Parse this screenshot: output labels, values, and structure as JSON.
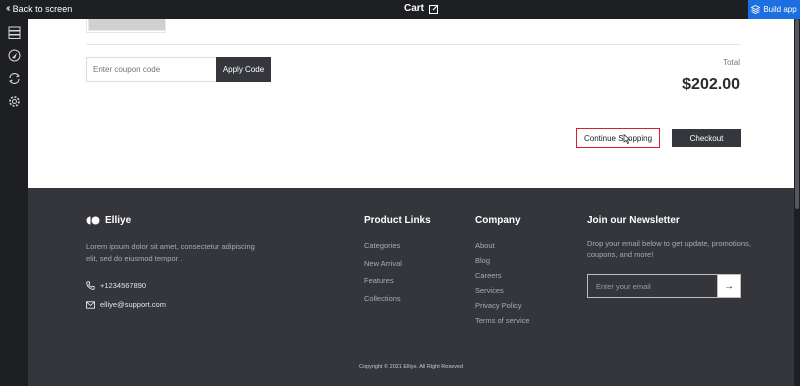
{
  "topbar": {
    "back_label": "Back to screen",
    "title": "Cart",
    "build_label": "Build app",
    "build_color": "#1b6fe0"
  },
  "rail": {
    "icons": [
      "layers-icon",
      "navigation-icon",
      "sync-icon",
      "settings-icon"
    ]
  },
  "cart": {
    "coupon_placeholder": "Enter coupon code",
    "apply_label": "Apply Code",
    "total_label": "Total",
    "total_value": "$202.00",
    "continue_label": "Continue Shopping",
    "checkout_label": "Checkout",
    "highlight_color": "#d8202a"
  },
  "footer": {
    "brand": "Elliye",
    "description": "Lorem ipsum dolor sit amet, consectetur adipiscing elit, sed do eiusmod tempor .",
    "phone": "+1234567890",
    "email": "elliye@support.com",
    "product_links": {
      "title": "Product Links",
      "items": [
        "Categories",
        "New Arrival",
        "Features",
        "Collections"
      ]
    },
    "company": {
      "title": "Company",
      "items": [
        "About",
        "Blog",
        "Careers",
        "Services",
        "Privacy Policy",
        "Terms of service"
      ]
    },
    "newsletter": {
      "title": "Join our Newsletter",
      "description": "Drop your email below to get update, promotions, coupons, and more!",
      "placeholder": "Enter your email",
      "submit_symbol": "→"
    },
    "copyright": "Copyright © 2021 Elliye. All Right Reseved"
  }
}
